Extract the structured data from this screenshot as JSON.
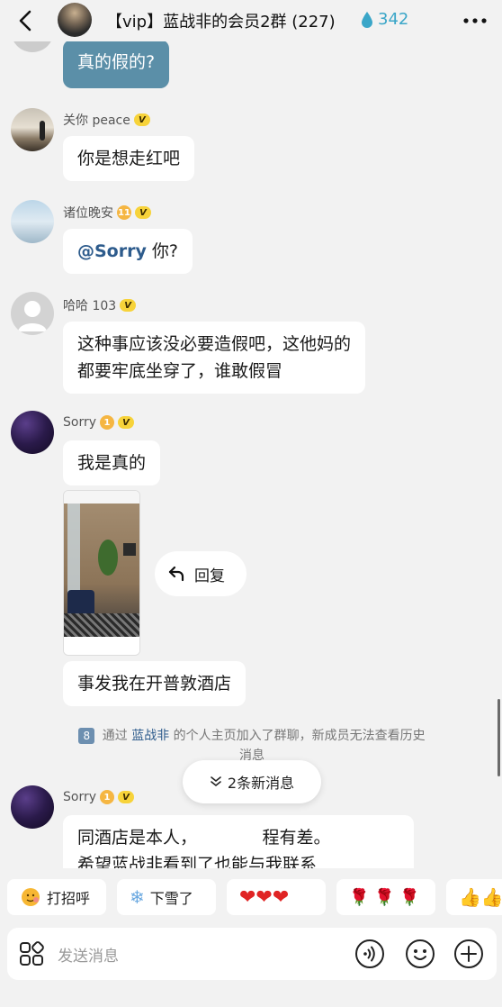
{
  "header": {
    "title": "【vip】蓝战非的会员2群 (227)",
    "score": "342"
  },
  "messages": {
    "m1_text": "真的假的?",
    "m2_sender": "关你 peace",
    "m2_text": "你是想走红吧",
    "m3_sender": "诸位晚安",
    "m3_level": "11",
    "m3_mention": "@Sorry",
    "m3_text": " 你?",
    "m4_sender": "哈哈 103",
    "m4_line1": "这种事应该没必要造假吧，这他妈的",
    "m4_line2": "都要牢底坐穿了，谁敢假冒",
    "m5_sender": "Sorry",
    "m5_level": "1",
    "m5_text": "我是真的",
    "reply_label": "回复",
    "m6_text": "事发我在开普敦酒店",
    "m7_sender": "Sorry",
    "m7_level": "1",
    "m7_line1": "同酒店是本人，            程有差。",
    "m7_line2": "希望蓝战非看到了也能与我联系"
  },
  "badge_v": "V",
  "system": {
    "num": "8",
    "prefix": "通过",
    "link": "蓝战非",
    "suffix": "的个人主页加入了群聊，新成员无法查看历史",
    "line2": "消息"
  },
  "new_messages": "2条新消息",
  "quick": {
    "chip1": "打招呼",
    "chip2": "下雪了",
    "chip3": "❤❤❤",
    "chip4": "🌹 🌹 🌹",
    "chip5": "👍👍"
  },
  "input": {
    "placeholder": "发送消息"
  },
  "colors": {
    "accent": "#3aa6c8",
    "own_bubble": "#5b8fa8",
    "link": "#2d5b8c",
    "badge": "#f7d33a"
  }
}
